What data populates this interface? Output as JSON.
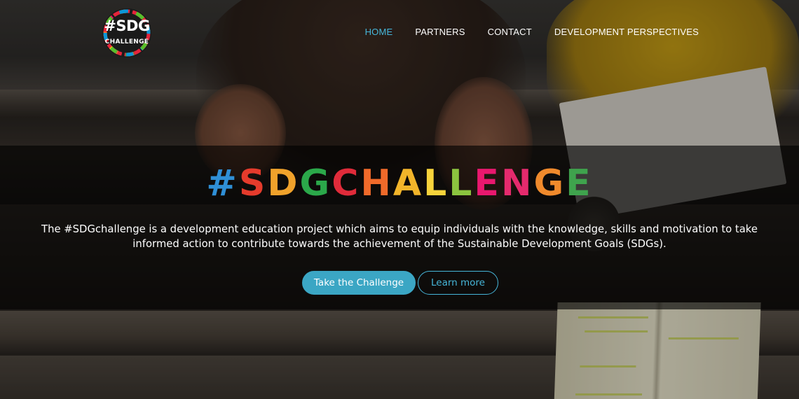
{
  "logo": {
    "line1": "#SDG",
    "line2": "CHALLENGE"
  },
  "nav": {
    "items": [
      {
        "label": "HOME",
        "active": true
      },
      {
        "label": "PARTNERS",
        "active": false
      },
      {
        "label": "CONTACT",
        "active": false
      },
      {
        "label": "DEVELOPMENT PERSPECTIVES",
        "active": false
      }
    ]
  },
  "hero": {
    "headline_letters": [
      {
        "ch": "#",
        "color": "#2f8fd6"
      },
      {
        "ch": "S",
        "color": "#e53b2c"
      },
      {
        "ch": "D",
        "color": "#f0a22b"
      },
      {
        "ch": "G",
        "color": "#2ba84a"
      },
      {
        "ch": "C",
        "color": "#e02b3a"
      },
      {
        "ch": "H",
        "color": "#f06a2a"
      },
      {
        "ch": "A",
        "color": "#f2b52a"
      },
      {
        "ch": "L",
        "color": "#f6d33b"
      },
      {
        "ch": "L",
        "color": "#8bc43f"
      },
      {
        "ch": "E",
        "color": "#e9186e"
      },
      {
        "ch": "N",
        "color": "#e52a6d"
      },
      {
        "ch": "G",
        "color": "#f08a2c"
      },
      {
        "ch": "E",
        "color": "#3fa34d"
      }
    ],
    "description_line1": "The #SDGchallenge is a development education project which aims to equip individuals with the knowledge, skills and motivation to take",
    "description_line2": "informed action to contribute towards the achievement of the Sustainable Development Goals (SDGs).",
    "primary_button": "Take the Challenge",
    "secondary_button": "Learn more"
  },
  "colors": {
    "accent": "#46b6d9",
    "primary_button_bg": "#3ba6c4"
  }
}
